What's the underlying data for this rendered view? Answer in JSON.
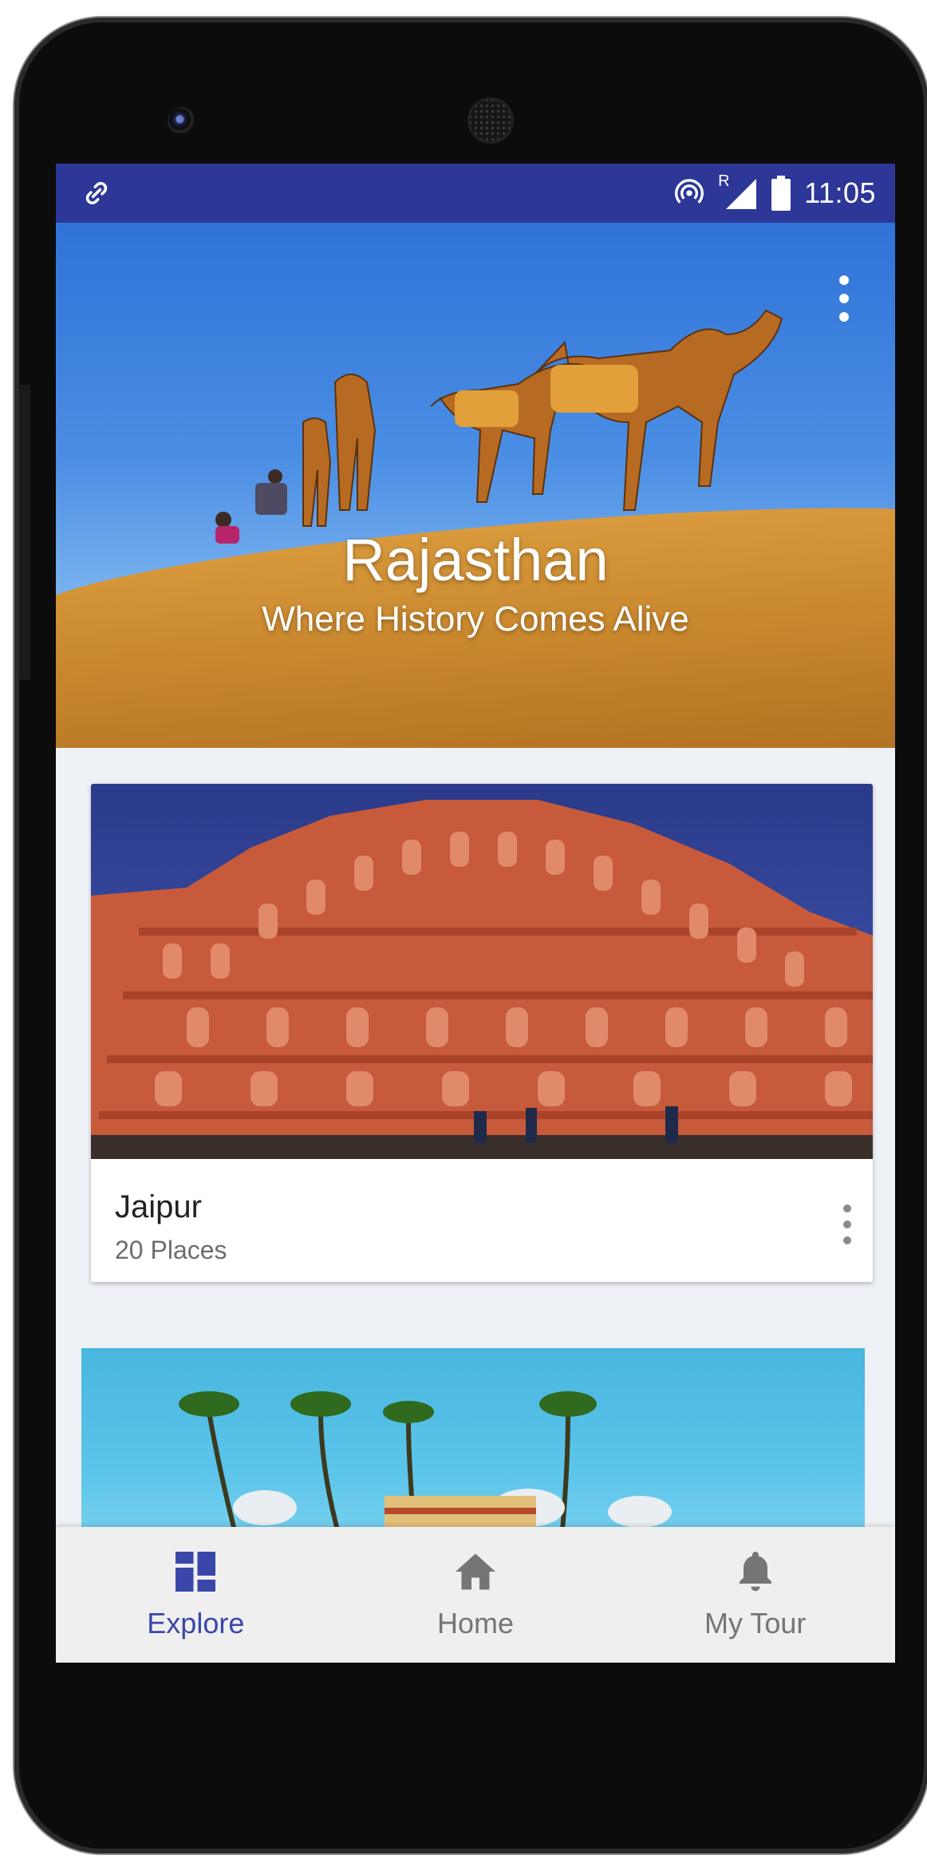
{
  "status_bar": {
    "time": "11:05",
    "network_badge": "R",
    "icons": [
      "link-icon",
      "hotspot-icon",
      "signal-icon",
      "battery-icon"
    ],
    "color": "#2c3797"
  },
  "hero": {
    "title": "Rajasthan",
    "subtitle": "Where History Comes Alive",
    "overflow_icon": "more-vertical-icon"
  },
  "cards": [
    {
      "title": "Jaipur",
      "subtitle": "20 Places",
      "overflow_icon": "more-vertical-icon"
    }
  ],
  "bottom_nav": {
    "items": [
      {
        "label": "Explore",
        "icon": "explore-grid-icon",
        "active": true
      },
      {
        "label": "Home",
        "icon": "home-icon",
        "active": false
      },
      {
        "label": "My Tour",
        "icon": "bell-icon",
        "active": false
      }
    ],
    "active_color": "#3a47a8",
    "inactive_color": "#757575"
  }
}
